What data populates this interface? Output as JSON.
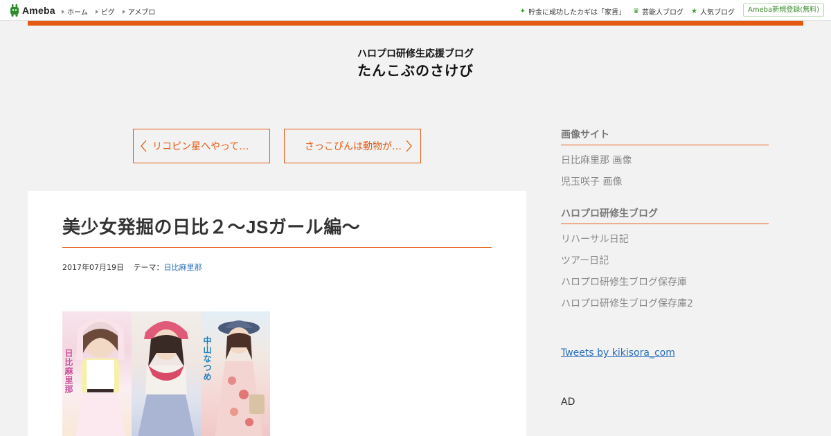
{
  "topbar": {
    "logo_text": "Ameba",
    "nav": [
      "ホーム",
      "ピグ",
      "アメブロ"
    ],
    "right_nav": [
      {
        "label": "貯金に成功したカギは「家賃」",
        "icon": "sparkle-icon"
      },
      {
        "label": "芸能人ブログ",
        "icon": "crown-icon"
      },
      {
        "label": "人気ブログ",
        "icon": "star-icon"
      }
    ],
    "register_label": "Ameba新規登録(無料)"
  },
  "colors": {
    "accent": "#e55a12",
    "brand_green": "#3a9a2e",
    "link": "#2a6ebb"
  },
  "header": {
    "subtitle": "ハロプロ研修生応援ブログ",
    "title": "たんこぶのさけび"
  },
  "pager": {
    "prev_label": "リコピン星へやって…",
    "next_label": "さっこぴんは動物が…"
  },
  "article": {
    "title": "美少女発掘の日比２～JSガール編～",
    "date": "2017年07月19日",
    "theme_prefix": "テーマ：",
    "theme": "日比麻里那",
    "photo_captions": [
      "日比麻里那",
      "中山なつめ"
    ]
  },
  "sidebar": {
    "sections": [
      {
        "heading": "画像サイト",
        "links": [
          "日比麻里那 画像",
          "児玉咲子 画像"
        ]
      },
      {
        "heading": "ハロプロ研修生ブログ",
        "links": [
          "リハーサル日記",
          "ツアー日記",
          "ハロプロ研修生ブログ保存庫",
          "ハロプロ研修生ブログ保存庫2"
        ]
      }
    ],
    "tweets_link": "Tweets by kikisora_com",
    "ad_label": "AD"
  }
}
